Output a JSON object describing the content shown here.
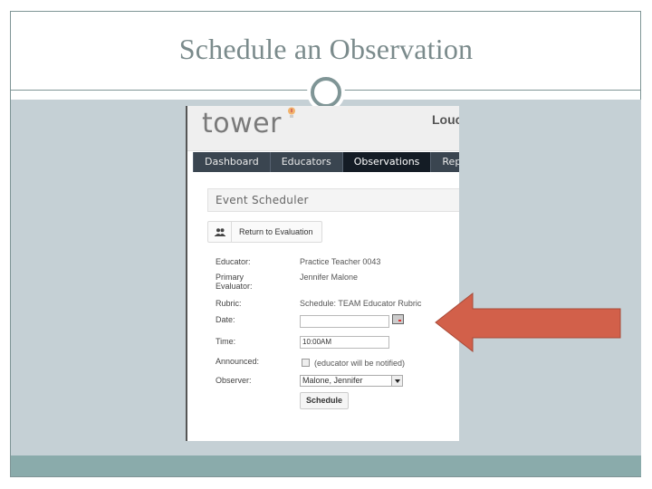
{
  "slide": {
    "title": "Schedule an Observation",
    "colors": {
      "frame": "#7f9596",
      "content_band": "#c5d0d5",
      "footer_band": "#8aabab",
      "arrow": "#d2604a",
      "title_text": "#7b8b8c"
    }
  },
  "app": {
    "logo": "tower",
    "district_partial": "Louc",
    "nav": {
      "items": [
        {
          "label": "Dashboard",
          "active": false
        },
        {
          "label": "Educators",
          "active": false
        },
        {
          "label": "Observations",
          "active": true
        },
        {
          "label": "Repo",
          "active": false
        }
      ]
    },
    "panel_title": "Event Scheduler",
    "return_button": {
      "icon": "users-icon",
      "label": "Return to Evaluation"
    },
    "form": {
      "educator": {
        "label": "Educator:",
        "value": "Practice Teacher 0043"
      },
      "primary_evaluator": {
        "label_line1": "Primary",
        "label_line2": "Evaluator:",
        "value": "Jennifer Malone"
      },
      "rubric": {
        "label": "Rubric:",
        "value": "Schedule: TEAM Educator Rubric"
      },
      "date": {
        "label": "Date:",
        "value": "",
        "icon": "calendar-icon"
      },
      "time": {
        "label": "Time:",
        "value": "10:00AM"
      },
      "announced": {
        "label": "Announced:",
        "checked": false,
        "note": "(educator will be notified)"
      },
      "observer": {
        "label": "Observer:",
        "selected": "Malone, Jennifer"
      },
      "submit_label": "Schedule"
    }
  }
}
